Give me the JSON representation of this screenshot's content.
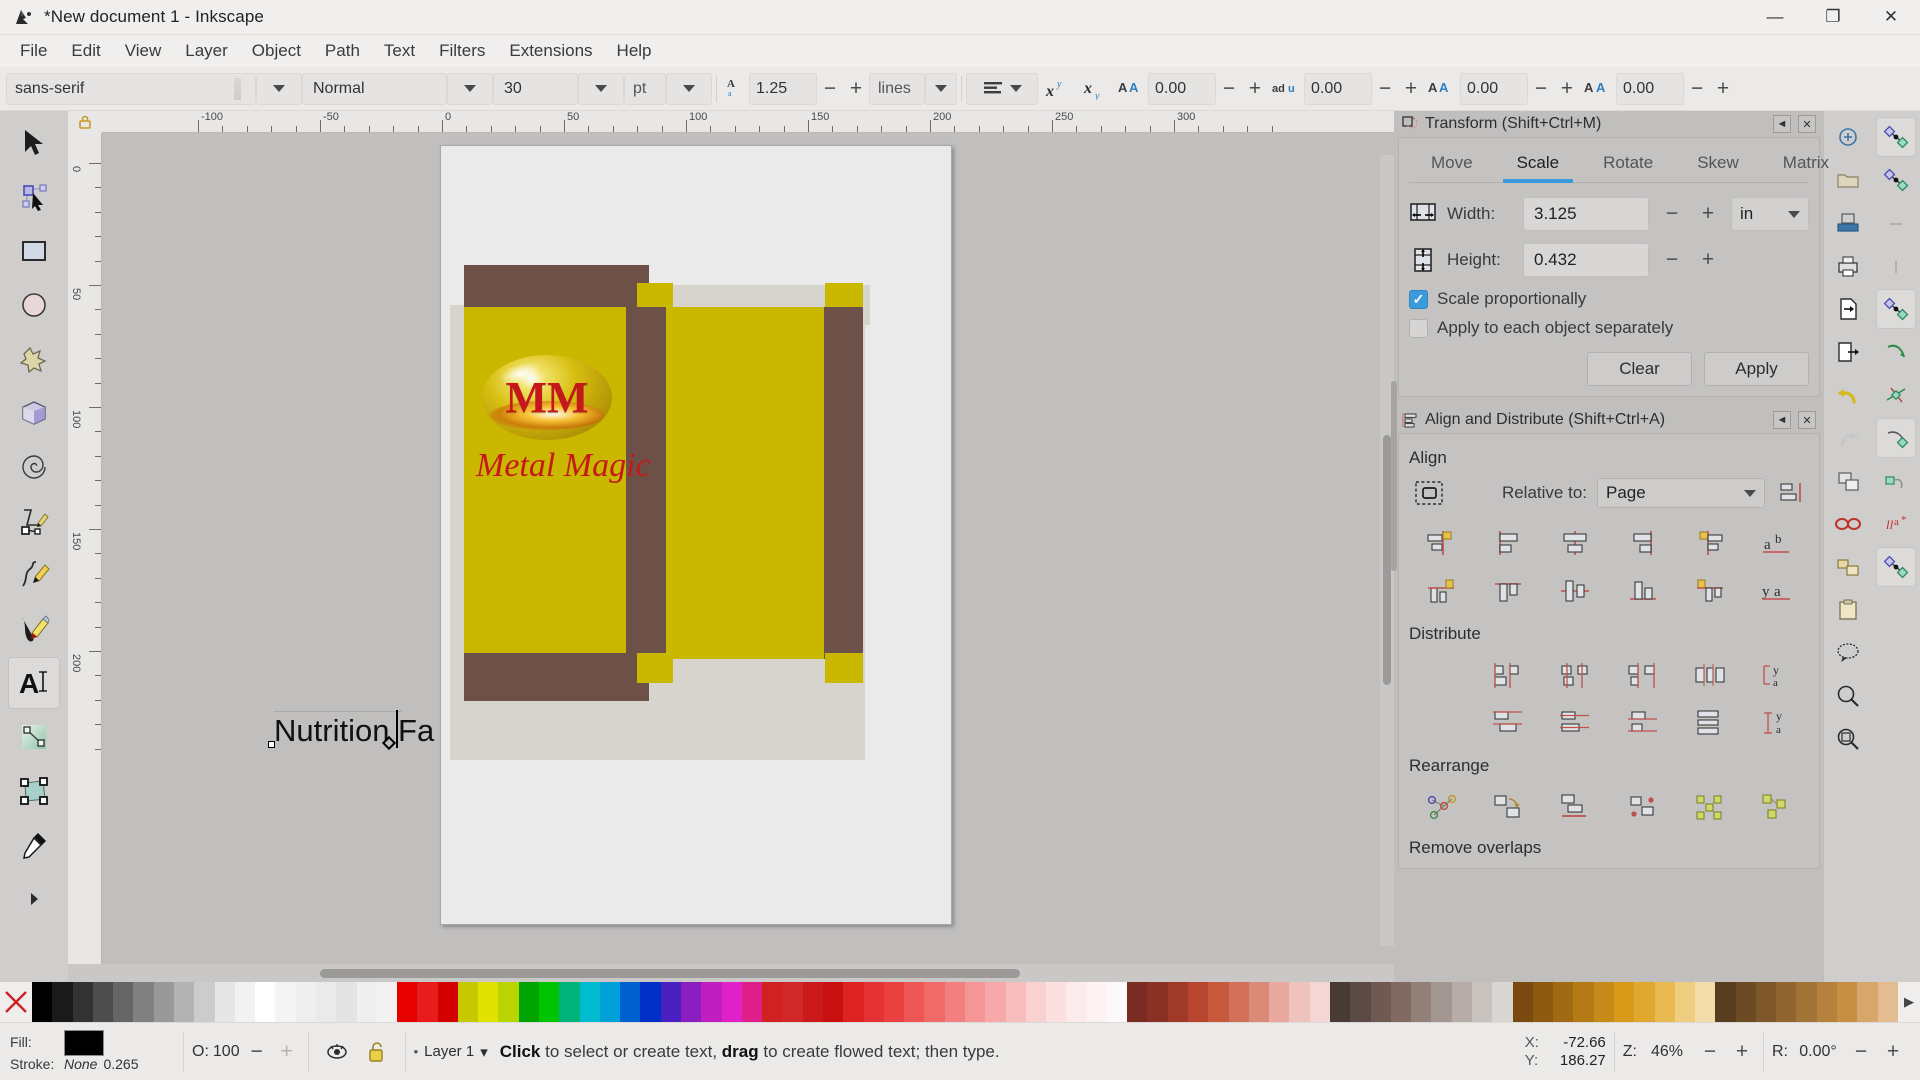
{
  "window": {
    "title": "*New document 1 - Inkscape",
    "app_icon": "inkscape-logo-icon",
    "minimize": "—",
    "maximize": "❐",
    "close": "✕"
  },
  "menubar": {
    "items": [
      "File",
      "Edit",
      "View",
      "Layer",
      "Object",
      "Path",
      "Text",
      "Filters",
      "Extensions",
      "Help"
    ]
  },
  "text_toolbar": {
    "font_family": "sans-serif",
    "font_style": "Normal",
    "font_size": "30",
    "font_size_unit": "pt",
    "line_spacing_icon": "line-height-icon",
    "line_spacing": "1.25",
    "line_spacing_unit": "lines",
    "alignment_icon": "text-align-icon",
    "superscript_icon": "superscript-icon",
    "subscript_icon": "subscript-icon",
    "letter_spacing_icon": "letter-spacing-icon",
    "letter_spacing": "0.00",
    "word_spacing_icon": "word-spacing-icon",
    "word_spacing": "0.00",
    "horizontal_kerning_icon": "horizontal-kerning-icon",
    "horizontal_kerning": "0.00",
    "vertical_kerning_icon": "vertical-kerning-icon",
    "vertical_kerning": "0.00",
    "minus": "−",
    "plus": "+"
  },
  "toolbox": {
    "tools": [
      {
        "name": "selector-tool",
        "icon": "arrow-cursor-icon",
        "active": false
      },
      {
        "name": "node-tool",
        "icon": "node-editor-icon",
        "active": false
      },
      {
        "name": "rectangle-tool",
        "icon": "rectangle-icon",
        "active": false
      },
      {
        "name": "ellipse-tool",
        "icon": "ellipse-icon",
        "active": false
      },
      {
        "name": "star-tool",
        "icon": "star-icon",
        "active": false
      },
      {
        "name": "3dbox-tool",
        "icon": "cube-icon",
        "active": false
      },
      {
        "name": "spiral-tool",
        "icon": "spiral-icon",
        "active": false
      },
      {
        "name": "bezier-tool",
        "icon": "pen-icon",
        "active": false
      },
      {
        "name": "pencil-tool",
        "icon": "pencil-icon",
        "active": false
      },
      {
        "name": "calligraphy-tool",
        "icon": "calligraphy-pen-icon",
        "active": false
      },
      {
        "name": "text-tool",
        "icon": "text-a-icon",
        "active": true
      },
      {
        "name": "gradient-tool",
        "icon": "gradient-icon",
        "active": false
      },
      {
        "name": "transform-tool",
        "icon": "transform-handles-icon",
        "active": false
      },
      {
        "name": "dropper-tool",
        "icon": "eyedropper-icon",
        "active": false
      },
      {
        "name": "more-tools",
        "icon": "chevron-right-icon",
        "active": false
      }
    ]
  },
  "rulers": {
    "horizontal_labels": [
      "-100",
      "-50",
      "0",
      "50",
      "100",
      "150",
      "200",
      "250",
      "300"
    ],
    "vertical_labels": [
      "0",
      "50",
      "100",
      "150",
      "200"
    ],
    "lock_icon": "ruler-lock-icon"
  },
  "canvas": {
    "text_object": "Nutrition Fa",
    "logo": {
      "initials": "MM",
      "name": "Metal Magic"
    }
  },
  "transform_dialog": {
    "icon": "transform-icon",
    "title": "Transform (Shift+Ctrl+M)",
    "dock_icon": "dock-icon",
    "close_icon": "close-icon",
    "tabs": [
      {
        "label": "Move",
        "active": false
      },
      {
        "label": "Scale",
        "active": true
      },
      {
        "label": "Rotate",
        "active": false
      },
      {
        "label": "Skew",
        "active": false
      },
      {
        "label": "Matrix",
        "active": false
      }
    ],
    "width_label": "Width:",
    "width_value": "3.125",
    "width_icon": "scale-width-icon",
    "height_label": "Height:",
    "height_value": "0.432",
    "height_icon": "scale-height-icon",
    "unit": "in",
    "scale_proportionally": "Scale proportionally",
    "scale_proportionally_checked": true,
    "apply_each_object": "Apply to each object separately",
    "apply_each_object_checked": false,
    "clear_button": "Clear",
    "apply_button": "Apply",
    "minus": "−",
    "plus": "+"
  },
  "align_dialog": {
    "icon": "align-icon",
    "title": "Align and Distribute (Shift+Ctrl+A)",
    "dock_icon": "dock-icon",
    "close_icon": "close-icon",
    "align_heading": "Align",
    "treat_selection_icon": "treat-selection-as-group-icon",
    "relative_to_label": "Relative to:",
    "relative_to_value": "Page",
    "move_as_group_icon": "move-as-group-icon",
    "align_row1_icons": [
      "align-right-edge-to-left-anchor-icon",
      "align-left-edges-icon",
      "center-on-vertical-axis-icon",
      "align-right-edges-icon",
      "align-left-edge-to-right-anchor-icon",
      "text-anchor-left-icon"
    ],
    "align_row2_icons": [
      "align-bottom-edge-to-top-anchor-icon",
      "align-top-edges-icon",
      "center-on-horizontal-axis-icon",
      "align-bottom-edges-icon",
      "align-top-edge-to-bottom-anchor-icon",
      "text-baseline-icon"
    ],
    "distribute_heading": "Distribute",
    "distribute_row1_icons": [
      "distribute-left-edges-icon",
      "distribute-centers-horizontally-icon",
      "distribute-right-edges-icon",
      "distribute-even-horizontal-gaps-icon",
      "text-distribute-horizontal-icon"
    ],
    "distribute_row2_icons": [
      "distribute-top-edges-icon",
      "distribute-centers-vertically-icon",
      "distribute-bottom-edges-icon",
      "distribute-even-vertical-gaps-icon",
      "text-distribute-vertical-icon"
    ],
    "rearrange_heading": "Rearrange",
    "rearrange_icons": [
      "graph-layout-icon",
      "exchange-selected-icon",
      "exchange-selection-order-icon",
      "exchange-random-icon",
      "unclump-icon",
      "randomize-positions-icon"
    ],
    "remove_overlaps_heading": "Remove overlaps"
  },
  "command_bar": {
    "buttons": [
      {
        "name": "new-document-button",
        "icon": "new-document-icon"
      },
      {
        "name": "open-document-button",
        "icon": "folder-open-icon"
      },
      {
        "name": "save-document-button",
        "icon": "save-icon"
      },
      {
        "name": "print-button",
        "icon": "printer-icon"
      },
      {
        "name": "import-button",
        "icon": "import-icon"
      },
      {
        "name": "export-button",
        "icon": "export-icon"
      },
      {
        "name": "undo-button",
        "icon": "undo-arrow-icon"
      },
      {
        "name": "redo-button",
        "icon": "redo-arrow-icon"
      },
      {
        "name": "duplicate-button",
        "icon": "duplicate-icon"
      },
      {
        "name": "group-button",
        "icon": "group-icon"
      },
      {
        "name": "ungroup-button",
        "icon": "ungroup-icon"
      },
      {
        "name": "paste-button",
        "icon": "clipboard-icon"
      },
      {
        "name": "xml-editor-button",
        "icon": "xml-editor-icon"
      },
      {
        "name": "zoom-drawing-button",
        "icon": "zoom-drawing-icon"
      },
      {
        "name": "zoom-page-button",
        "icon": "zoom-page-icon"
      }
    ]
  },
  "snap_bar": {
    "buttons": [
      {
        "name": "enable-snapping-button",
        "icon": "snap-master-icon",
        "active": true
      },
      {
        "name": "snap-bounding-box-button",
        "icon": "snap-bbox-icon",
        "active": false
      },
      {
        "name": "snap-bbox-edges-button",
        "icon": "snap-bbox-edge-icon",
        "active": false
      },
      {
        "name": "snap-bbox-corners-button",
        "icon": "snap-bbox-corner-icon",
        "active": false
      },
      {
        "name": "snap-nodes-button",
        "icon": "snap-nodes-icon",
        "active": true
      },
      {
        "name": "snap-paths-button",
        "icon": "snap-path-icon",
        "active": false
      },
      {
        "name": "snap-path-intersections-button",
        "icon": "snap-path-intersection-icon",
        "active": false
      },
      {
        "name": "snap-cusp-nodes-button",
        "icon": "snap-cusp-icon",
        "active": true
      },
      {
        "name": "snap-smooth-nodes-button",
        "icon": "snap-smooth-icon",
        "active": false
      },
      {
        "name": "snap-text-anchors-button",
        "icon": "snap-text-icon",
        "active": false
      },
      {
        "name": "snap-others-button",
        "icon": "snap-others-icon",
        "active": true
      }
    ]
  },
  "palette": {
    "x_icon": "no-color-icon",
    "left_arrow": "◀",
    "right_arrow": "▶",
    "swatches": [
      "#000000",
      "#1a1a1a",
      "#333333",
      "#4d4d4d",
      "#666666",
      "#808080",
      "#999999",
      "#b3b3b3",
      "#cccccc",
      "#e6e6e6",
      "#f2f2f2",
      "#ffffff",
      "#f5f5f5",
      "#efefef",
      "#eaeaea",
      "#e4e4e4",
      "#efefef",
      "#f2f2f2",
      "#e60000",
      "#e81c1c",
      "#d40000",
      "#c8c800",
      "#e2e200",
      "#b9d400",
      "#00a400",
      "#00c400",
      "#00b37a",
      "#00bcd0",
      "#00a0d8",
      "#0060d0",
      "#0030c8",
      "#4a20c0",
      "#8a1ec0",
      "#c01ec0",
      "#e020c8",
      "#e01e8a",
      "#d32020",
      "#d02828",
      "#cc1a1a",
      "#c81010",
      "#dd2222",
      "#e53232",
      "#ea4040",
      "#ee5555",
      "#f06a6a",
      "#f38080",
      "#f59595",
      "#f7a8a8",
      "#f9bcbc",
      "#fad0d0",
      "#fce0e0",
      "#fdeaea",
      "#fef3f3",
      "#fafafa",
      "#7a2b22",
      "#8a3024",
      "#a03a28",
      "#b8462e",
      "#c85a3c",
      "#d2705a",
      "#dc8a78",
      "#e8a8a0",
      "#f0c2bc",
      "#f4d6d4",
      "#4a3a36",
      "#5c4a44",
      "#6e5a52",
      "#806a62",
      "#928078",
      "#a49690",
      "#b6aca8",
      "#c8c2be",
      "#dad6d4",
      "#7a4a10",
      "#8d5a12",
      "#a06a14",
      "#b37a16",
      "#c68a18",
      "#d99a1a",
      "#e0a82e",
      "#e8ba50",
      "#eecc80",
      "#f2dca8",
      "#5a3c1e",
      "#6c4a24",
      "#7e582a",
      "#906630",
      "#a27436",
      "#b4823c",
      "#c69042",
      "#d8a66a",
      "#e4bc92"
    ]
  },
  "statusbar": {
    "fill_label": "Fill:",
    "fill_color": "#000000",
    "stroke_label": "Stroke:",
    "stroke_value": "None",
    "stroke_width": "0.265",
    "opacity_label": "O:",
    "opacity_value": "100",
    "opacity_minus": "−",
    "opacity_plus": "+",
    "visibility_icon": "eye-icon",
    "lock_icon": "unlock-icon",
    "layer_indicator_icon": "layer-dot-icon",
    "layer_name": "Layer 1",
    "layer_caret": "▾",
    "message_bold_1": "Click",
    "message_part_1": " to select or create text, ",
    "message_bold_2": "drag",
    "message_part_2": " to create flowed text; then type.",
    "x_label": "X:",
    "x_value": "-72.66",
    "y_label": "Y:",
    "y_value": "186.27",
    "z_label": "Z:",
    "zoom_value": "46%",
    "zoom_minus": "−",
    "zoom_plus": "+",
    "r_label": "R:",
    "rotation_value": "0.00°",
    "rotation_minus": "−",
    "rotation_plus": "+"
  }
}
